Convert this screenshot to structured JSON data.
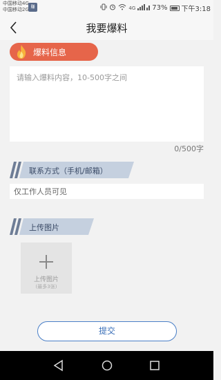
{
  "status_bar": {
    "carrier_1": "中国移动4G",
    "carrier_2": "中国移动2G",
    "carrier_icon_text": "赚",
    "network": "4G",
    "battery_pct": "73%",
    "time": "下午3:18"
  },
  "header": {
    "title": "我要爆料"
  },
  "report": {
    "tag_label": "爆料信息",
    "content_placeholder": "请输入爆料内容，10-500字之间",
    "content_value": "",
    "counter": "0/500字"
  },
  "contact": {
    "label": "联系方式（手机/邮箱）",
    "placeholder": "仅工作人员可见",
    "value": ""
  },
  "upload": {
    "label": "上传图片",
    "tile_label": "上传图片",
    "tile_hint": "(最多3张)"
  },
  "submit_label": "提交",
  "colors": {
    "accent_red": "#e6654a",
    "banner_blue": "#c5d0df",
    "button_blue": "#4a7fc7"
  }
}
